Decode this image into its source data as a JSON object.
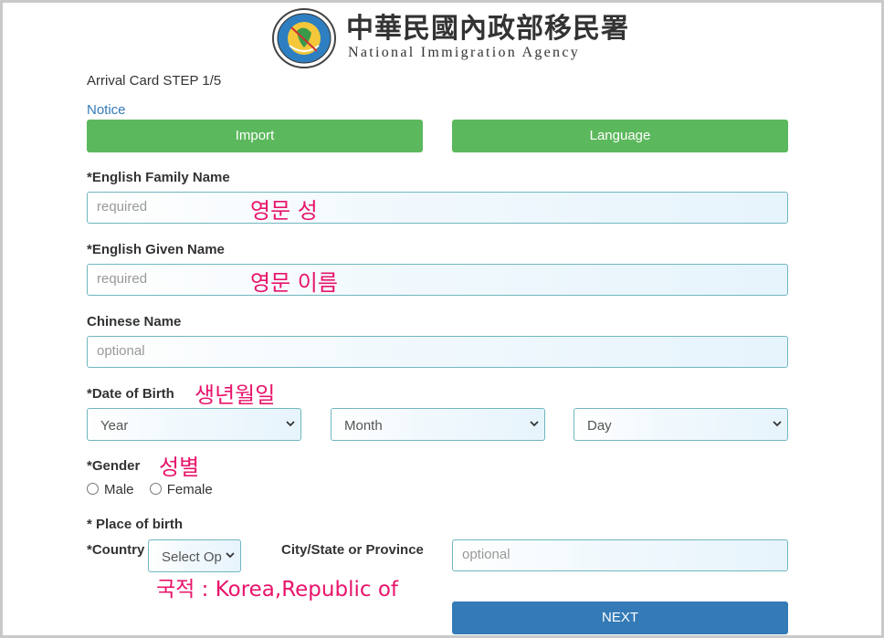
{
  "header": {
    "agency_name_cn": "中華民國內政部移民署",
    "agency_name_en": "National Immigration Agency"
  },
  "form": {
    "step_text": "Arrival Card STEP 1/5",
    "notice_link": "Notice",
    "import_button": "Import",
    "language_button": "Language",
    "family_name": {
      "label": "*English Family Name",
      "placeholder": "required",
      "annotation": "영문 성"
    },
    "given_name": {
      "label": "*English Given Name",
      "placeholder": "required",
      "annotation": "영문 이름"
    },
    "chinese_name": {
      "label": "Chinese Name",
      "placeholder": "optional"
    },
    "dob": {
      "label": "*Date of Birth",
      "annotation": "생년월일",
      "year": "Year",
      "month": "Month",
      "day": "Day"
    },
    "gender": {
      "label": "*Gender",
      "annotation": "성별",
      "male": "Male",
      "female": "Female"
    },
    "place_of_birth": {
      "label": "* Place of birth",
      "country_label": "*Country",
      "country_select": "Select Op",
      "city_label": "City/State or Province",
      "city_placeholder": "optional",
      "annotation": "국적 : Korea,Republic of"
    },
    "next_button": "NEXT"
  },
  "colors": {
    "green_button": "#5cb85c",
    "blue_button": "#337ab7",
    "link": "#337ab7",
    "annotation": "#e8146b",
    "input_border": "#6fb7bf"
  }
}
